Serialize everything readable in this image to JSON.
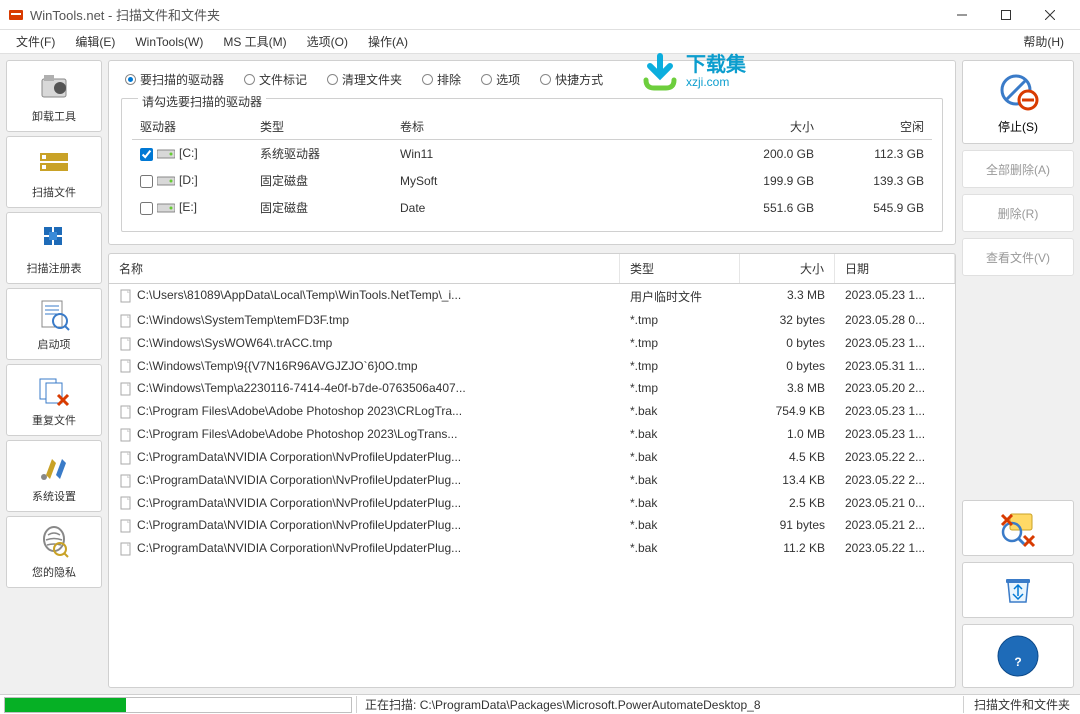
{
  "window": {
    "title": "WinTools.net - 扫描文件和文件夹"
  },
  "menu": {
    "file": "文件(F)",
    "edit": "编辑(E)",
    "wintools": "WinTools(W)",
    "mstools": "MS 工具(M)",
    "options": "选项(O)",
    "operations": "操作(A)",
    "help": "帮助(H)"
  },
  "watermark": {
    "line1": "下载集",
    "line2": "xzji.com"
  },
  "sidebar": [
    {
      "label": "卸载工具"
    },
    {
      "label": "扫描文件"
    },
    {
      "label": "扫描注册表"
    },
    {
      "label": "启动项"
    },
    {
      "label": "重复文件"
    },
    {
      "label": "系统设置"
    },
    {
      "label": "您的隐私"
    }
  ],
  "tabs": [
    {
      "label": "要扫描的驱动器",
      "active": true
    },
    {
      "label": "文件标记"
    },
    {
      "label": "清理文件夹"
    },
    {
      "label": "排除"
    },
    {
      "label": "选项"
    },
    {
      "label": "快捷方式"
    }
  ],
  "drives_panel": {
    "legend": "请勾选要扫描的驱动器",
    "headers": {
      "drive": "驱动器",
      "type": "类型",
      "label": "卷标",
      "size": "大小",
      "free": "空闲"
    },
    "rows": [
      {
        "checked": true,
        "name": "[C:]",
        "type": "系统驱动器",
        "label": "Win11",
        "size": "200.0 GB",
        "free": "112.3 GB"
      },
      {
        "checked": false,
        "name": "[D:]",
        "type": "固定磁盘",
        "label": "MySoft",
        "size": "199.9 GB",
        "free": "139.3 GB"
      },
      {
        "checked": false,
        "name": "[E:]",
        "type": "固定磁盘",
        "label": "Date",
        "size": "551.6 GB",
        "free": "545.9 GB"
      }
    ]
  },
  "right": {
    "stop": "停止(S)",
    "delete_all": "全部删除(A)",
    "delete": "删除(R)",
    "view_file": "查看文件(V)"
  },
  "results": {
    "headers": {
      "name": "名称",
      "type": "类型",
      "size": "大小",
      "date": "日期"
    },
    "rows": [
      {
        "name": "C:\\Users\\81089\\AppData\\Local\\Temp\\WinTools.NetTemp\\_i...",
        "type": "用户临时文件",
        "size": "3.3 MB",
        "date": "2023.05.23 1..."
      },
      {
        "name": "C:\\Windows\\SystemTemp\\temFD3F.tmp",
        "type": "*.tmp",
        "size": "32 bytes",
        "date": "2023.05.28 0..."
      },
      {
        "name": "C:\\Windows\\SysWOW64\\.trACC.tmp",
        "type": "*.tmp",
        "size": "0 bytes",
        "date": "2023.05.23 1..."
      },
      {
        "name": "C:\\Windows\\Temp\\9{{V7N16R96AVGJZJO`6}0O.tmp",
        "type": "*.tmp",
        "size": "0 bytes",
        "date": "2023.05.31 1..."
      },
      {
        "name": "C:\\Windows\\Temp\\a2230116-7414-4e0f-b7de-0763506a407...",
        "type": "*.tmp",
        "size": "3.8 MB",
        "date": "2023.05.20 2..."
      },
      {
        "name": "C:\\Program Files\\Adobe\\Adobe Photoshop 2023\\CRLogTra...",
        "type": "*.bak",
        "size": "754.9 KB",
        "date": "2023.05.23 1..."
      },
      {
        "name": "C:\\Program Files\\Adobe\\Adobe Photoshop 2023\\LogTrans...",
        "type": "*.bak",
        "size": "1.0 MB",
        "date": "2023.05.23 1..."
      },
      {
        "name": "C:\\ProgramData\\NVIDIA Corporation\\NvProfileUpdaterPlug...",
        "type": "*.bak",
        "size": "4.5 KB",
        "date": "2023.05.22 2..."
      },
      {
        "name": "C:\\ProgramData\\NVIDIA Corporation\\NvProfileUpdaterPlug...",
        "type": "*.bak",
        "size": "13.4 KB",
        "date": "2023.05.22 2..."
      },
      {
        "name": "C:\\ProgramData\\NVIDIA Corporation\\NvProfileUpdaterPlug...",
        "type": "*.bak",
        "size": "2.5 KB",
        "date": "2023.05.21 0..."
      },
      {
        "name": "C:\\ProgramData\\NVIDIA Corporation\\NvProfileUpdaterPlug...",
        "type": "*.bak",
        "size": "91 bytes",
        "date": "2023.05.21 2..."
      },
      {
        "name": "C:\\ProgramData\\NVIDIA Corporation\\NvProfileUpdaterPlug...",
        "type": "*.bak",
        "size": "11.2 KB",
        "date": "2023.05.22 1..."
      }
    ]
  },
  "status": {
    "progress_pct": 35,
    "scanning_label": "正在扫描:",
    "scanning_path": "C:\\ProgramData\\Packages\\Microsoft.PowerAutomateDesktop_8",
    "right": "扫描文件和文件夹"
  }
}
